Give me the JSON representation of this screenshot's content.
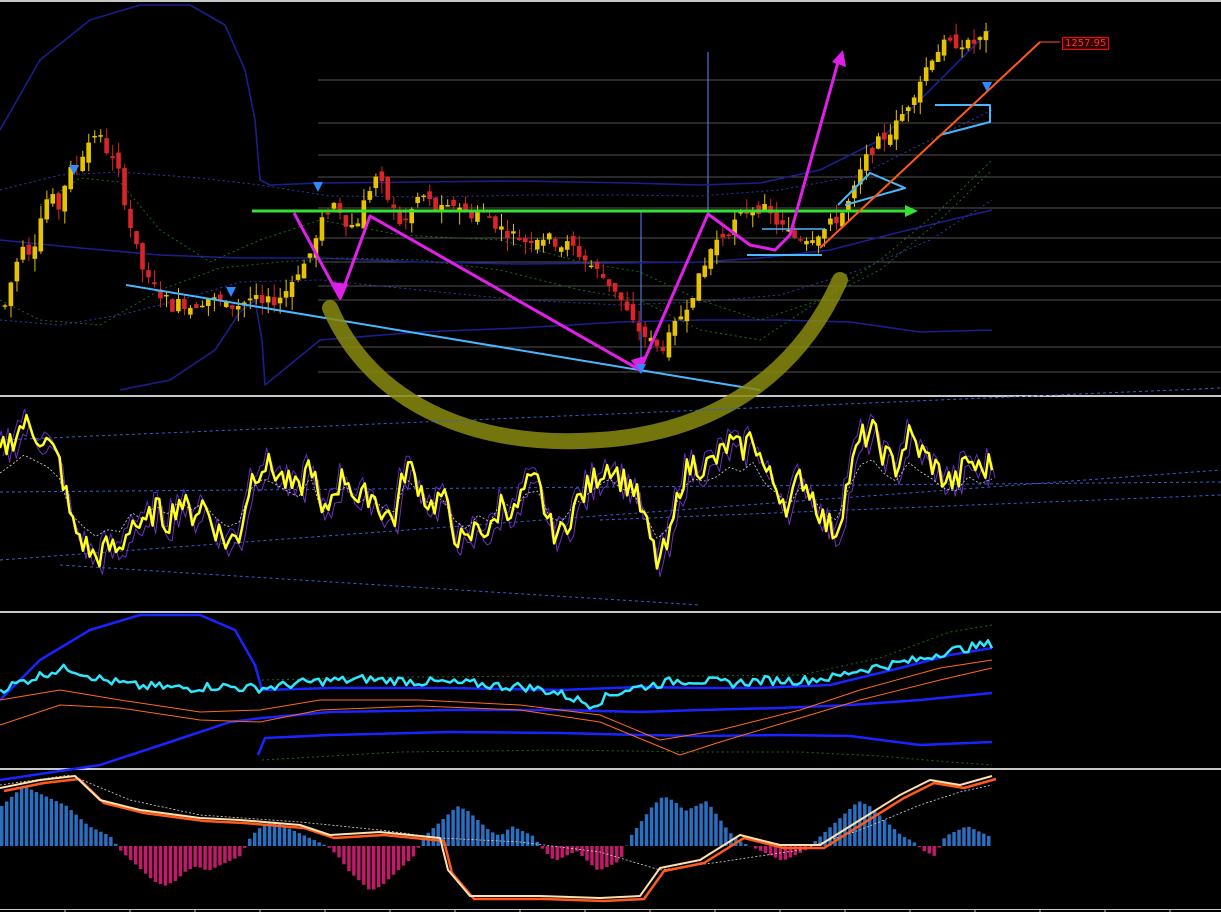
{
  "colors": {
    "background": "#000000",
    "separator": "#c8c8c8",
    "grid": "#8a8a8a",
    "candle_up": "#e6c300",
    "candle_down": "#d8252a",
    "envelope": "#1a1f8c",
    "envelope_dotted": "#2c3bb0",
    "green_band": "#1c6a1c",
    "support_line": "#48b8ff",
    "resistance_line": "#36e030",
    "zigzag": "#e020e8",
    "cup": "#8a8a10",
    "trend_arrow": "#ff5a1a",
    "signal_arrow": "#2e8bff",
    "rsi": "#ffff20",
    "rsi_signal": "#7030c0",
    "bb_line": "#1a24ff",
    "cyan_line": "#2ee8ff",
    "orange_line": "#ff6a1a",
    "macd_pos": "#2a6fc0",
    "macd_neg": "#c01a6a",
    "macd_line": "#ffe0b0",
    "macd_signal": "#ff5a1a"
  },
  "price_label": "1257.95",
  "chart_data": [
    {
      "type": "line",
      "panel": "price",
      "series": [
        {
          "values": [
            40,
            48,
            55,
            52,
            60,
            66,
            62,
            70,
            72,
            76,
            80,
            78,
            74,
            70,
            60,
            52,
            46,
            44,
            42,
            40,
            41,
            40,
            41,
            42,
            41,
            40,
            40,
            41,
            42,
            40,
            41,
            42,
            44,
            48,
            50,
            54,
            60,
            64,
            62,
            58,
            60,
            66,
            70,
            66,
            62,
            58,
            62,
            66,
            64,
            62,
            62,
            64,
            62,
            61,
            62,
            60,
            58,
            57,
            56,
            55,
            56,
            56,
            55,
            54,
            54,
            52,
            50,
            48,
            46,
            44,
            40,
            36,
            34,
            32,
            30,
            32,
            36,
            40,
            44,
            48,
            54,
            56,
            58,
            60,
            62,
            63,
            62,
            60,
            58,
            56,
            56,
            56,
            57,
            58,
            60,
            62,
            66,
            72,
            76,
            78,
            80,
            82,
            86,
            90,
            94,
            98,
            100,
            100,
            101,
            100,
            101,
            102
          ]
        }
      ],
      "ylim": [
        20,
        110
      ],
      "annotations": [
        "resistance-line",
        "support-line",
        "zigzag-pattern",
        "cup-shape",
        "breakout-arrow",
        "trend-arrow"
      ]
    },
    {
      "type": "line",
      "panel": "oscillator",
      "series": [
        {
          "values": [
            75,
            82,
            90,
            85,
            80,
            70,
            40,
            30,
            22,
            28,
            26,
            42,
            36,
            48,
            40,
            52,
            44,
            50,
            38,
            30,
            34,
            62,
            70,
            66,
            60,
            55,
            72,
            40,
            58,
            64,
            50,
            56,
            46,
            42,
            70,
            60,
            48,
            54,
            36,
            28,
            40,
            34,
            52,
            44,
            58,
            60,
            38,
            34,
            48,
            56,
            64,
            70,
            62,
            58,
            40,
            20,
            30,
            62,
            70,
            68,
            72,
            80,
            76,
            84,
            66,
            58,
            48,
            64,
            54,
            40,
            36,
            62,
            82,
            86,
            74,
            68,
            84,
            76,
            70,
            62,
            60,
            72,
            66,
            70
          ]
        }
      ],
      "ylim": [
        0,
        100
      ]
    },
    {
      "type": "line",
      "panel": "bands",
      "series": [
        {
          "values": [
            50,
            54,
            58,
            62,
            64,
            60,
            56,
            54,
            52,
            52,
            51,
            51,
            52,
            52,
            51,
            51,
            52,
            54,
            55,
            56,
            56,
            57,
            56,
            56,
            55,
            55,
            54,
            54,
            53,
            52,
            52,
            50,
            48,
            44,
            40,
            46,
            50,
            52,
            54,
            56,
            56,
            55,
            54,
            55,
            56,
            56,
            56,
            57,
            58,
            62,
            64,
            66,
            68,
            70,
            74,
            76,
            78,
            80
          ]
        }
      ],
      "ylim": [
        0,
        100
      ]
    },
    {
      "type": "bar",
      "panel": "macd",
      "series": [
        {
          "values": [
            8,
            10,
            12,
            11,
            10,
            9,
            8,
            6,
            4,
            3,
            2,
            -1,
            -3,
            -5,
            -7,
            -8,
            -7,
            -5,
            -4,
            -5,
            -4,
            -3,
            -2,
            2,
            4,
            5,
            4,
            3,
            2,
            1,
            0,
            -2,
            -5,
            -7,
            -9,
            -8,
            -6,
            -4,
            -2,
            2,
            4,
            6,
            8,
            7,
            5,
            3,
            2,
            4,
            3,
            2,
            -1,
            -3,
            -2,
            -1,
            -3,
            -5,
            -4,
            -3,
            2,
            5,
            8,
            10,
            9,
            7,
            8,
            9,
            6,
            3,
            1,
            0,
            -1,
            -2,
            -3,
            -2,
            -1,
            1,
            3,
            5,
            7,
            9,
            8,
            6,
            4,
            2,
            1,
            -1,
            -2,
            2,
            3,
            4,
            3,
            2
          ]
        }
      ],
      "ylim": [
        -12,
        14
      ]
    }
  ]
}
